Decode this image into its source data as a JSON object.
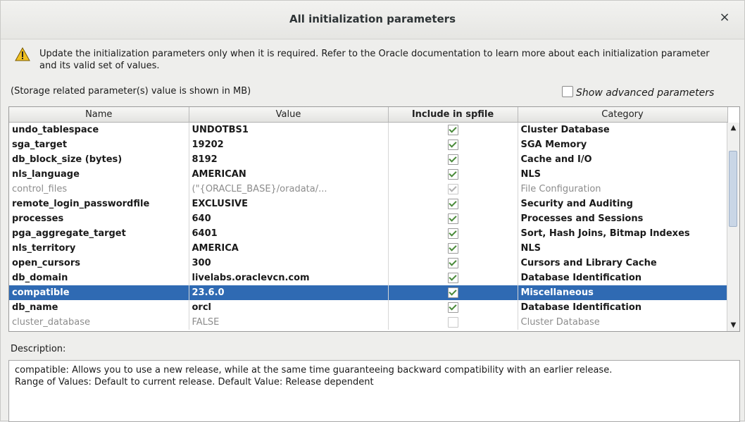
{
  "dialog": {
    "title": "All initialization parameters",
    "close_glyph": "×"
  },
  "warning": {
    "icon": "warning-icon",
    "text": "Update the initialization parameters only when it is required. Refer to the Oracle documentation to learn more about each initialization parameter and its valid set of values."
  },
  "storage_note": "(Storage related parameter(s) value is shown in MB)",
  "advanced": {
    "label": "Show advanced parameters",
    "checked": false
  },
  "table": {
    "columns": [
      "Name",
      "Value",
      "Include in spfile",
      "Category"
    ],
    "rows": [
      {
        "name": "undo_tablespace",
        "value": "UNDOTBS1",
        "include": true,
        "category": "Cluster Database",
        "state": "normal"
      },
      {
        "name": "sga_target",
        "value": "19202",
        "include": true,
        "category": "SGA Memory",
        "state": "normal"
      },
      {
        "name": "db_block_size (bytes)",
        "value": "8192",
        "include": true,
        "category": "Cache and I/O",
        "state": "normal"
      },
      {
        "name": "nls_language",
        "value": "AMERICAN",
        "include": true,
        "category": "NLS",
        "state": "normal"
      },
      {
        "name": "control_files",
        "value": "(\"{ORACLE_BASE}/oradata/...",
        "include": true,
        "category": "File Configuration",
        "state": "disabled"
      },
      {
        "name": "remote_login_passwordfile",
        "value": "EXCLUSIVE",
        "include": true,
        "category": "Security and Auditing",
        "state": "normal"
      },
      {
        "name": "processes",
        "value": "640",
        "include": true,
        "category": "Processes and Sessions",
        "state": "normal"
      },
      {
        "name": "pga_aggregate_target",
        "value": "6401",
        "include": true,
        "category": "Sort, Hash Joins, Bitmap Indexes",
        "state": "normal"
      },
      {
        "name": "nls_territory",
        "value": "AMERICA",
        "include": true,
        "category": "NLS",
        "state": "normal"
      },
      {
        "name": "open_cursors",
        "value": "300",
        "include": true,
        "category": "Cursors and Library Cache",
        "state": "normal"
      },
      {
        "name": "db_domain",
        "value": "livelabs.oraclevcn.com",
        "include": true,
        "category": "Database Identification",
        "state": "normal"
      },
      {
        "name": "compatible",
        "value": "23.6.0",
        "include": true,
        "category": "Miscellaneous",
        "state": "selected"
      },
      {
        "name": "db_name",
        "value": "orcl",
        "include": true,
        "category": "Database Identification",
        "state": "normal"
      },
      {
        "name": "cluster_database",
        "value": "FALSE",
        "include": false,
        "category": "Cluster Database",
        "state": "disabled"
      }
    ]
  },
  "description": {
    "label": "Description:",
    "lines": [
      "compatible: Allows you to use a new release, while at the same time guaranteeing backward compatibility with an earlier release.",
      "Range of Values: Default to current release. Default Value: Release dependent"
    ]
  },
  "colors": {
    "selection": "#2f6ab3",
    "check": "#4a8a3a",
    "warning": "#f0c020"
  }
}
